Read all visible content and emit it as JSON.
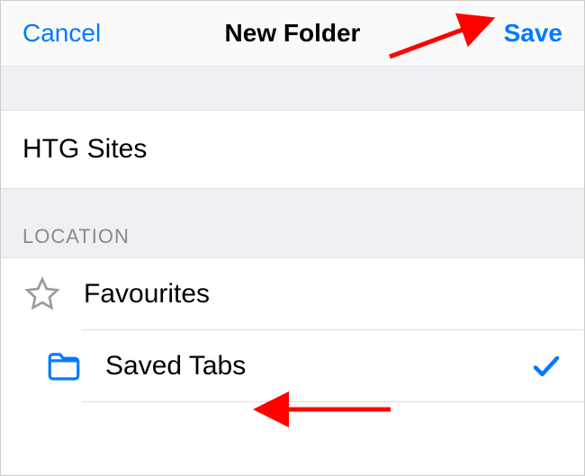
{
  "header": {
    "cancel_label": "Cancel",
    "title": "New Folder",
    "save_label": "Save"
  },
  "folder_name": "HTG Sites",
  "location_section_label": "LOCATION",
  "locations": [
    {
      "label": "Favourites",
      "icon": "star-icon",
      "selected": false
    },
    {
      "label": "Saved Tabs",
      "icon": "folder-icon",
      "selected": true
    }
  ],
  "colors": {
    "accent": "#007aff",
    "annotation": "#ff0000",
    "muted": "#9a9aa0"
  }
}
